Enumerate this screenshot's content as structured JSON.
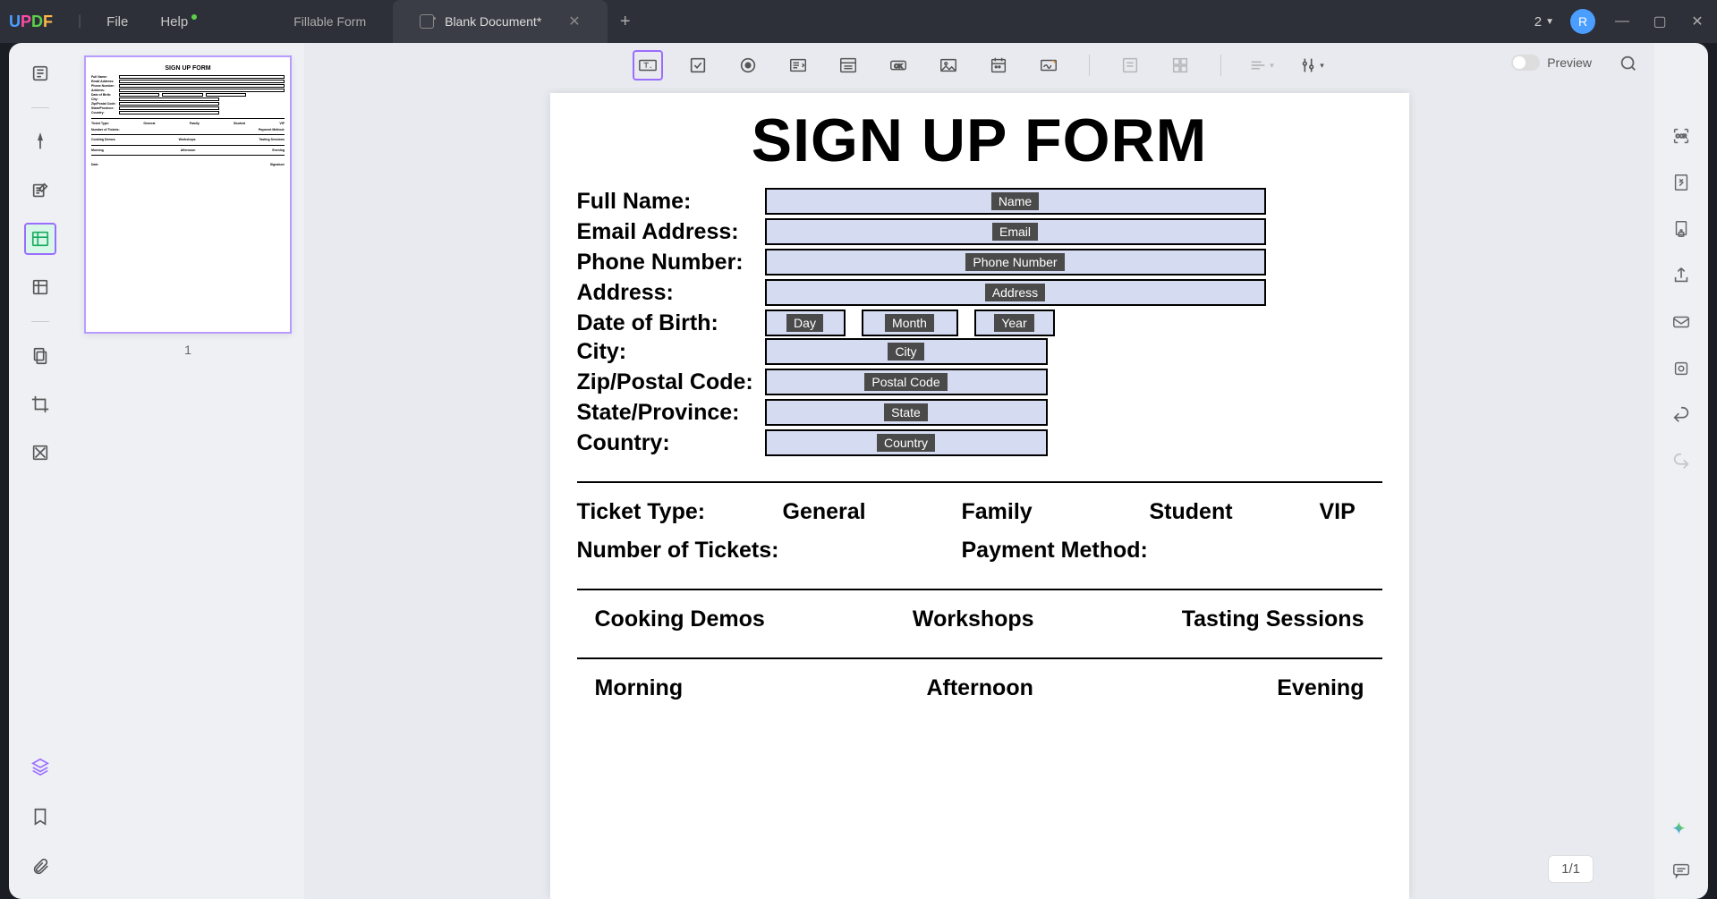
{
  "app": {
    "logo_u": "U",
    "logo_p": "P",
    "logo_d": "D",
    "logo_f": "F"
  },
  "menu": {
    "file": "File",
    "help": "Help"
  },
  "tabs": [
    {
      "label": "Fillable Form",
      "active": false
    },
    {
      "label": "Blank Document*",
      "active": true
    }
  ],
  "titlebar": {
    "count": "2",
    "avatar": "R"
  },
  "toolbar": {
    "preview": "Preview"
  },
  "thumbnail": {
    "num": "1"
  },
  "form": {
    "title": "SIGN UP FORM",
    "labels": {
      "fullname": "Full Name:",
      "email": "Email Address:",
      "phone": "Phone Number:",
      "address": "Address:",
      "dob": "Date of Birth:",
      "city": "City:",
      "zip": "Zip/Postal Code:",
      "state": "State/Province:",
      "country": "Country:",
      "ticket": "Ticket Type:",
      "numtix": "Number of Tickets:",
      "payment": "Payment Method:"
    },
    "placeholders": {
      "name": "Name",
      "email": "Email",
      "phone": "Phone Number",
      "address": "Address",
      "day": "Day",
      "month": "Month",
      "year": "Year",
      "city": "City",
      "postal": "Postal Code",
      "state": "State",
      "country": "Country"
    },
    "tickets": {
      "general": "General",
      "family": "Family",
      "student": "Student",
      "vip": "VIP"
    },
    "sessions": {
      "cooking": "Cooking Demos",
      "workshops": "Workshops",
      "tasting": "Tasting Sessions"
    },
    "times": {
      "morning": "Morning",
      "afternoon": "Afternoon",
      "evening": "Evening"
    }
  },
  "page_indicator": "1/1",
  "thumb": {
    "title": "SIGN UP FORM",
    "rows": [
      "Full Name:",
      "Email Address:",
      "Phone Number:",
      "Address:",
      "Date of Birth:",
      "City:",
      "Zip/Postal Code:",
      "State/Province:",
      "Country:"
    ],
    "r1": [
      "Ticket Type:",
      "General",
      "Family",
      "Student",
      "VIP"
    ],
    "r2": [
      "Number of Tickets:",
      "Payment Method:"
    ],
    "r3": [
      "Cooking Demos",
      "Workshops",
      "Tasting Sessions"
    ],
    "r4": [
      "Morning",
      "Afternoon",
      "Evening"
    ],
    "r5": [
      "Date",
      "",
      "Signature"
    ]
  }
}
